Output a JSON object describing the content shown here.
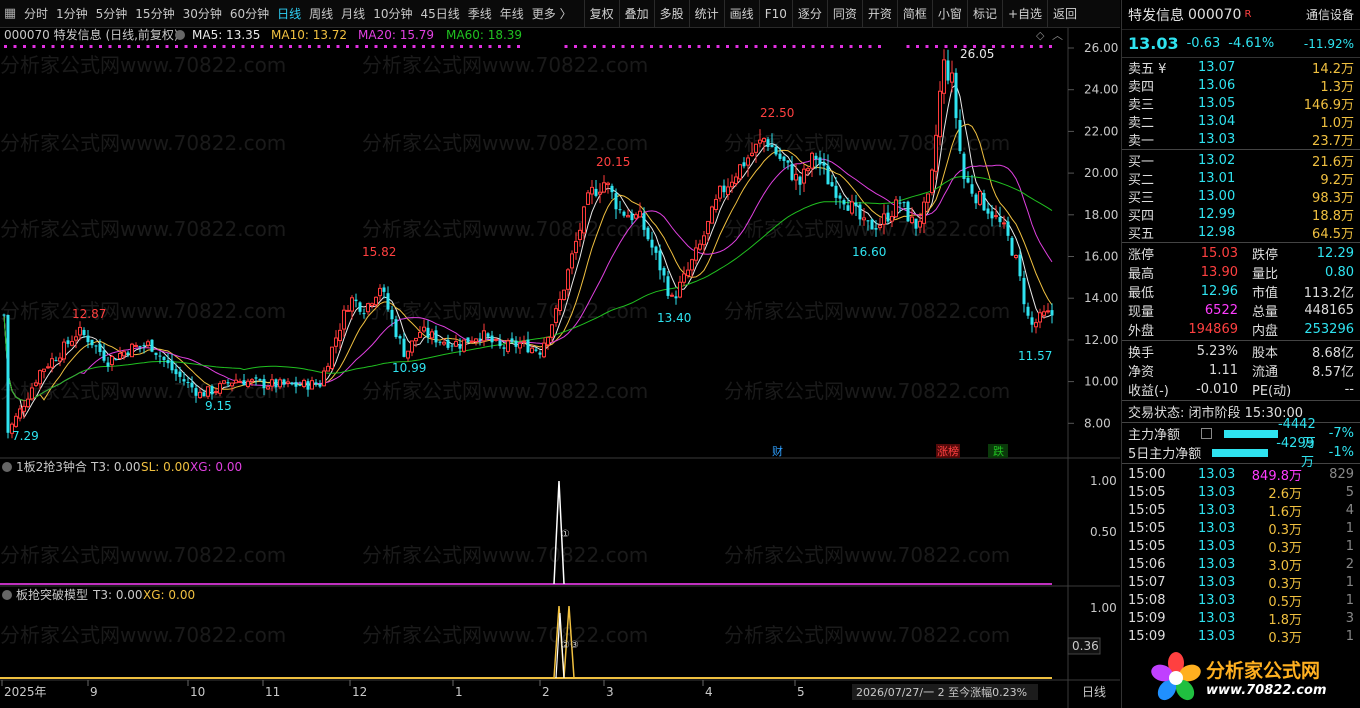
{
  "toolbar": {
    "periods": [
      "分时",
      "1分钟",
      "5分钟",
      "15分钟",
      "30分钟",
      "60分钟",
      "日线",
      "周线",
      "月线",
      "10分钟",
      "45日线",
      "季线",
      "年线",
      "更多 〉"
    ],
    "active": "日线",
    "buttons": [
      "复权",
      "叠加",
      "多股",
      "统计",
      "画线",
      "F10",
      "逐分",
      "同资",
      "开资",
      "简框",
      "小窗",
      "标记",
      "+自选",
      "返回"
    ]
  },
  "main_chart": {
    "title": "000070 特发信息 (日线,前复权)",
    "ma5_label": "MA5: 13.35",
    "ma10_label": "MA10: 13.72",
    "ma20_label": "MA20: 15.79",
    "ma60_label": "MA60: 18.39",
    "y_ticks": [
      "26.00",
      "24.00",
      "22.00",
      "20.00",
      "18.00",
      "16.00",
      "14.00",
      "12.00",
      "10.00",
      "8.00"
    ],
    "annotations": {
      "high_1287": "12.87",
      "low_729": "7.29",
      "low_915": "9.15",
      "high_1582": "15.82",
      "low_1099": "10.99",
      "high_2015": "20.15",
      "low_1340": "13.40",
      "high_2250": "22.50",
      "low_1660": "16.60",
      "high_2605": "26.05",
      "low_1157": "11.57"
    },
    "events": {
      "cai": "财",
      "zhangbang": "涨榜",
      "diebang": "跌"
    },
    "watermark": "分析家公式网www.70822.com",
    "colors": {
      "up": "#ff3b3b",
      "down": "#2fe3f0",
      "ma5": "#e8e8e8",
      "ma10": "#f0c040",
      "ma20": "#e040e0",
      "ma60": "#20c020"
    }
  },
  "sub1": {
    "title": "1板2抢3钟合",
    "t3": "T3: 0.00",
    "sl": "SL: 0.00",
    "xg": "XG: 0.00",
    "y_ticks": [
      "1.00",
      "0.50"
    ],
    "marker": "①"
  },
  "sub2": {
    "title": "板抢突破模型",
    "t3": "T3: 0.00",
    "xg": "XG: 0.00",
    "y_ticks": [
      "1.00"
    ],
    "marker": "②③",
    "value_box": "0.36"
  },
  "x_axis": {
    "labels": [
      "2025年",
      "9",
      "10",
      "11",
      "12",
      "1",
      "2",
      "3",
      "4",
      "5"
    ],
    "status": "2026/07/27/一 2 至今涨幅0.23%",
    "period": "日线"
  },
  "right_panel": {
    "name": "特发信息",
    "code": "000070",
    "badge": "R",
    "industry": "通信设备",
    "price": "13.03",
    "change": "-0.63",
    "change_pct": "-4.61%",
    "range_pct": "-11.92%",
    "asks": [
      {
        "label": "卖五 ¥",
        "price": "13.07",
        "vol": "14.2万"
      },
      {
        "label": "卖四",
        "price": "13.06",
        "vol": "1.3万"
      },
      {
        "label": "卖三",
        "price": "13.05",
        "vol": "146.9万"
      },
      {
        "label": "卖二",
        "price": "13.04",
        "vol": "1.0万"
      },
      {
        "label": "卖一",
        "price": "13.03",
        "vol": "23.7万"
      }
    ],
    "bids": [
      {
        "label": "买一",
        "price": "13.02",
        "vol": "21.6万"
      },
      {
        "label": "买二",
        "price": "13.01",
        "vol": "9.2万"
      },
      {
        "label": "买三",
        "price": "13.00",
        "vol": "98.3万"
      },
      {
        "label": "买四",
        "price": "12.99",
        "vol": "18.8万"
      },
      {
        "label": "买五",
        "price": "12.98",
        "vol": "64.5万"
      }
    ],
    "stats": [
      {
        "l": "涨停",
        "v": "15.03",
        "vc": "red",
        "l2": "跌停",
        "v2": "12.29",
        "v2c": "cyan"
      },
      {
        "l": "最高",
        "v": "13.90",
        "vc": "red",
        "l2": "量比",
        "v2": "0.80",
        "v2c": "cyan"
      },
      {
        "l": "最低",
        "v": "12.96",
        "vc": "cyan",
        "l2": "市值",
        "v2": "113.2亿",
        "v2c": "white"
      },
      {
        "l": "现量",
        "v": "6522",
        "vc": "magenta",
        "l2": "总量",
        "v2": "448165",
        "v2c": "white"
      },
      {
        "l": "外盘",
        "v": "194869",
        "vc": "red",
        "l2": "内盘",
        "v2": "253296",
        "v2c": "cyan"
      }
    ],
    "stats2": [
      {
        "l": "换手",
        "v": "5.23%",
        "vc": "white",
        "l2": "股本",
        "v2": "8.68亿",
        "v2c": "white"
      },
      {
        "l": "净资",
        "v": "1.11",
        "vc": "white",
        "l2": "流通",
        "v2": "8.57亿",
        "v2c": "white"
      },
      {
        "l": "收益(-)",
        "v": "-0.010",
        "vc": "white",
        "l2": "PE(动)",
        "v2": "--",
        "v2c": "white"
      }
    ],
    "trade_status": "交易状态: 闭市阶段 15:30:00",
    "flow": [
      {
        "label": "主力净额",
        "value": "-4442万",
        "pct": "-7%"
      },
      {
        "label": "5日主力净额",
        "value": "-4299万",
        "pct": "-1%"
      }
    ],
    "ticks": [
      {
        "t": "15:00",
        "p": "13.03",
        "v": "849.8万",
        "vc": "magenta",
        "n": "829"
      },
      {
        "t": "15:05",
        "p": "13.03",
        "v": "2.6万",
        "vc": "yellow",
        "n": "5"
      },
      {
        "t": "15:05",
        "p": "13.03",
        "v": "1.6万",
        "vc": "yellow",
        "n": "4"
      },
      {
        "t": "15:05",
        "p": "13.03",
        "v": "0.3万",
        "vc": "yellow",
        "n": "1"
      },
      {
        "t": "15:05",
        "p": "13.03",
        "v": "0.3万",
        "vc": "yellow",
        "n": "1"
      },
      {
        "t": "15:06",
        "p": "13.03",
        "v": "3.0万",
        "vc": "yellow",
        "n": "2"
      },
      {
        "t": "15:07",
        "p": "13.03",
        "v": "0.3万",
        "vc": "yellow",
        "n": "1"
      },
      {
        "t": "15:08",
        "p": "13.03",
        "v": "0.5万",
        "vc": "yellow",
        "n": "1"
      },
      {
        "t": "15:09",
        "p": "13.03",
        "v": "1.8万",
        "vc": "yellow",
        "n": "3"
      },
      {
        "t": "15:09",
        "p": "13.03",
        "v": "0.3万",
        "vc": "yellow",
        "n": "1"
      }
    ],
    "logo": {
      "main": "分析家公式网",
      "url": "www.70822.com"
    }
  }
}
